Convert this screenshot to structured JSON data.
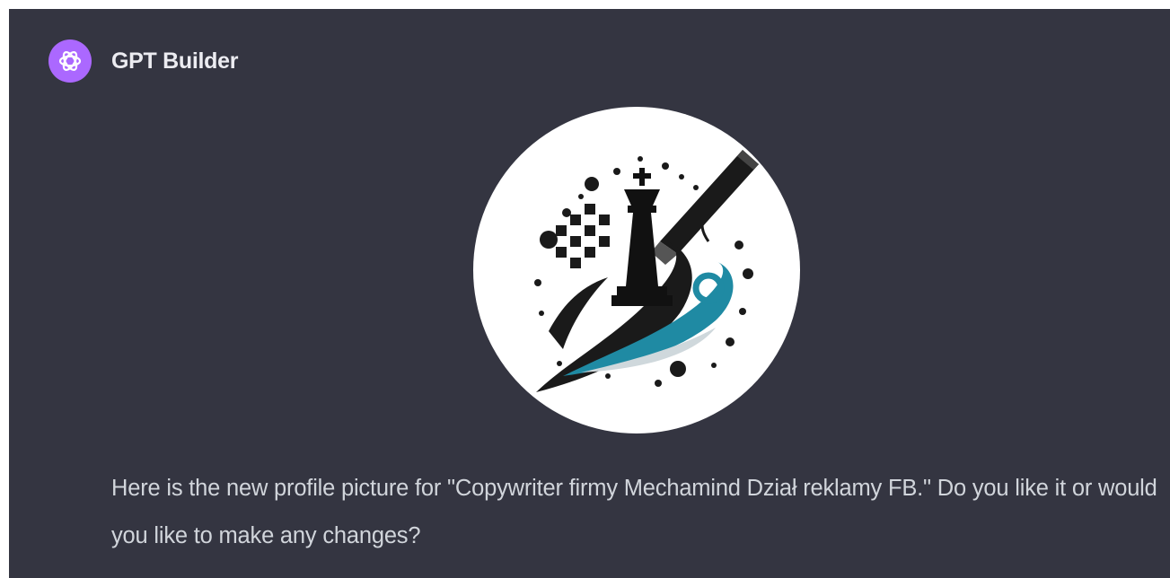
{
  "message": {
    "author": "GPT Builder",
    "avatar_icon": "openai-logo-icon",
    "avatar_color": "#ab68ff",
    "text": "Here is the new profile picture for \"Copywriter firmy Mechamind Dział reklamy FB.\" Do you like it or would you like to make any changes?",
    "image_icon": "chess-king-pen-logo-icon"
  },
  "colors": {
    "background": "#343541",
    "text": "#d1d5db",
    "author_text": "#ececf1",
    "accent_teal": "#1f8aa3"
  }
}
